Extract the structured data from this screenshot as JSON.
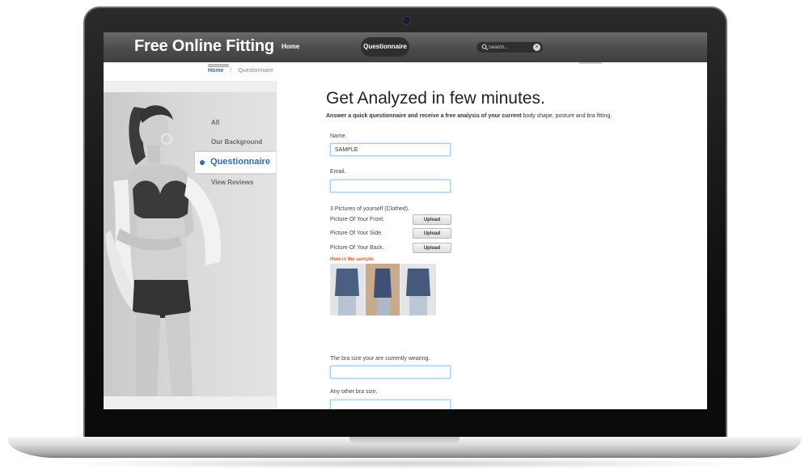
{
  "header": {
    "brand": "Free Online Fitting",
    "nav": [
      {
        "label": "Home"
      },
      {
        "label": "Questionnaire"
      }
    ],
    "search_placeholder": "Search..."
  },
  "breadcrumb": {
    "home": "Home",
    "separator": "/",
    "current": "Questionnaire"
  },
  "sidebar": {
    "items": [
      {
        "label": "All"
      },
      {
        "label": "Our Background"
      },
      {
        "label": "Questionnaire",
        "active": true
      },
      {
        "label": "View Reviews"
      }
    ]
  },
  "main": {
    "title": "Get Analyzed in few minutes.",
    "subtitle_bold": "Answer a quick questionnaire and receive a free analysis of your current",
    "subtitle_rest": " body shape, posture and bra fitting.",
    "form": {
      "name_label": "Name.",
      "name_value": "SAMPLE",
      "email_label": "Email.",
      "email_value": "",
      "pictures_label": "3 Pictures of yourself (Clothed).",
      "pictures": [
        {
          "label": "Picture Of Your Front.",
          "button": "Upload"
        },
        {
          "label": "Picture Of Your Side.",
          "button": "Upload"
        },
        {
          "label": "Picture Of Your Back.",
          "button": "Upload"
        }
      ],
      "sample_label": "Here is the sample.",
      "bra_size_label": "The bra size your are currently wearing.",
      "bra_size_value": "",
      "other_bra_label": "Any other bra size.",
      "other_bra_value": ""
    }
  },
  "colors": {
    "accent": "#2a6db8",
    "sample_label": "#e2651b",
    "topbar": "#4c4c4c"
  }
}
